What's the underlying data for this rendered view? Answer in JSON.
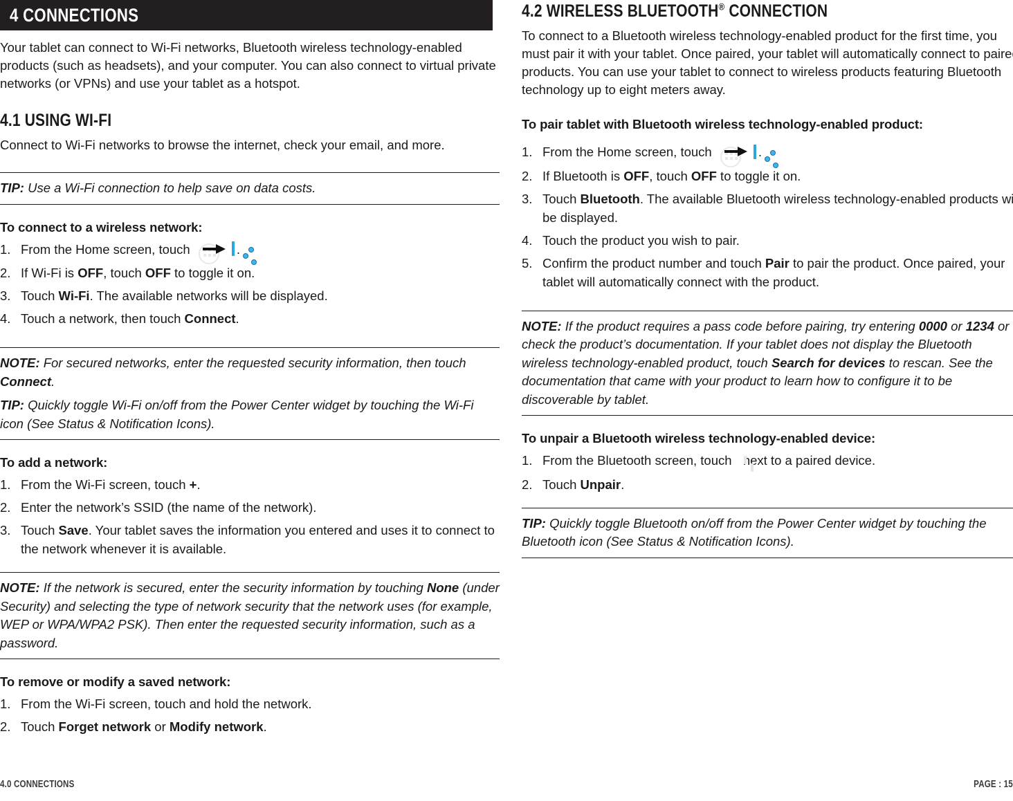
{
  "chapter": {
    "title": "4 CONNECTIONS"
  },
  "left_column": {
    "intro": "Your tablet can connect to Wi-Fi networks, Bluetooth wireless technology-enabled products (such as headsets), and your computer. You can also connect to virtual private networks (or VPNs) and use your tablet as a hotspot.",
    "section_4_1": {
      "heading": "4.1 USING WI-FI",
      "intro": "Connect to Wi-Fi networks to browse the internet, check your email, and more.",
      "tip_1": {
        "label": "TIP:",
        "text": " Use a Wi-Fi connection to help save on data costs."
      },
      "proc_connect": {
        "title": "To connect to a wireless network:",
        "step1_prefix": "From the Home screen, touch ",
        "step1_suffix": ".",
        "step2_a": "If Wi-Fi is ",
        "step2_b": "OFF",
        "step2_c": ", touch ",
        "step2_d": "OFF",
        "step2_e": " to toggle it on.",
        "step3_a": "Touch ",
        "step3_b": "Wi-Fi",
        "step3_c": ". The available networks will be displayed.",
        "step4_a": "Touch a network, then touch ",
        "step4_b": "Connect",
        "step4_c": "."
      },
      "note_1": {
        "label": "NOTE:",
        "text_a": " For secured networks, enter the requested security information, then touch ",
        "bold_b": "Connect",
        "text_c": "."
      },
      "tip_2": {
        "label": "TIP:",
        "text": " Quickly toggle Wi-Fi on/off from the Power Center widget by touching the Wi-Fi icon (See Status & Notification Icons)."
      },
      "proc_add": {
        "title": "To add a network:",
        "step1_a": "From the Wi-Fi screen, touch ",
        "step1_b": "+",
        "step1_c": ".",
        "step2": "Enter the network’s SSID (the name of the network).",
        "step3_a": "Touch ",
        "step3_b": "Save",
        "step3_c": ". Your tablet saves the information you entered and uses it to connect to the network whenever it is available."
      },
      "note_2": {
        "label": "NOTE:",
        "text_a": " If the network is secured, enter the security information by touching ",
        "bold_b": "None",
        "text_c": " (under Security) and selecting the type of network security that the network uses (for example, WEP or WPA/WPA2 PSK). Then enter the requested security information, such as a password."
      },
      "proc_remove": {
        "title": "To remove or modify a saved network:",
        "step1": "From the Wi-Fi screen, touch and hold the network.",
        "step2_a": "Touch ",
        "step2_b": "Forget network",
        "step2_c": " or ",
        "step2_d": "Modify network",
        "step2_e": "."
      }
    }
  },
  "right_column": {
    "section_4_2": {
      "heading_a": "4.2 WIRELESS BLUETOOTH",
      "heading_reg": "®",
      "heading_b": " CONNECTION",
      "intro": "To connect to a Bluetooth wireless technology-enabled product for the first time, you must pair it with your tablet. Once paired, your tablet will automatically connect to paired products. You can use your tablet to connect to wireless products featuring Bluetooth technology up to eight meters away.",
      "proc_pair": {
        "title": "To pair tablet with Bluetooth wireless technology-enabled product:",
        "step1_prefix": "From the Home screen, touch ",
        "step1_suffix": ".",
        "step2_a": "If Bluetooth is ",
        "step2_b": "OFF",
        "step2_c": ", touch ",
        "step2_d": "OFF",
        "step2_e": " to toggle it on.",
        "step3_a": "Touch ",
        "step3_b": "Bluetooth",
        "step3_c": ". The available Bluetooth wireless technology-enabled products will be displayed.",
        "step4": "Touch the product you wish to pair.",
        "step5_a": "Confirm the product number and touch ",
        "step5_b": "Pair",
        "step5_c": " to pair the product. Once paired, your tablet will automatically connect with the product."
      },
      "note_1": {
        "label": "NOTE:",
        "text_a": " If the product requires a pass code before pairing, try entering ",
        "bold_b": "0000",
        "text_c": " or ",
        "bold_d": "1234",
        "text_e": " or check the product’s documentation. If your tablet does not display the Bluetooth wireless technology-enabled product, touch ",
        "bold_f": "Search for devices",
        "text_g": " to rescan. See the documentation that came with your product to learn how to configure it to be discoverable by tablet."
      },
      "proc_unpair": {
        "title": "To unpair a Bluetooth wireless technology-enabled device:",
        "step1_prefix": "From the Bluetooth screen, touch ",
        "step1_suffix": " next to a paired device.",
        "step2_a": "Touch ",
        "step2_b": "Unpair",
        "step2_c": "."
      },
      "tip_1": {
        "label": "TIP:",
        "text": " Quickly toggle Bluetooth on/off from the Power Center widget by touching the Bluetooth icon (See Status & Notification Icons)."
      }
    }
  },
  "footer": {
    "left": "4.0 CONNECTIONS",
    "right": "PAGE : 15"
  },
  "icons": {
    "app_drawer": "app-drawer-icon",
    "settings": "settings-sliders-icon",
    "arrow": "right-arrow-icon",
    "device_settings": "device-settings-icon"
  },
  "colors": {
    "bar_background": "#231f20",
    "text": "#1a1a1a",
    "accent_blue": "#2fc0f5",
    "footer_text": "#3a3a3a"
  }
}
